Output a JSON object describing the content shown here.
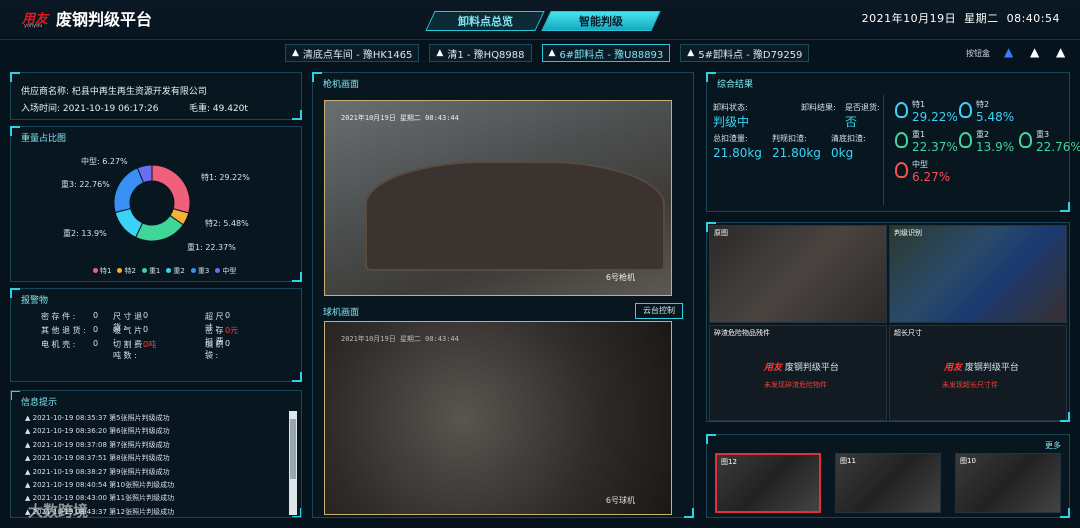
{
  "header": {
    "logo": "用友",
    "logo_sub": "yonyou",
    "title": "废钢判级平台",
    "tabs": [
      "卸料点总览",
      "智能判级"
    ],
    "active_tab": 1,
    "date": "2021年10月19日",
    "weekday": "星期二",
    "time": "08:40:54"
  },
  "vehicles": [
    {
      "label": "清底点车间 - 豫HK1465"
    },
    {
      "label": "清1 - 豫HQ8988"
    },
    {
      "label": "6#卸料点 - 豫U88893",
      "active": true
    },
    {
      "label": "5#卸料点 - 豫D79259"
    }
  ],
  "alarm_box": "按钮盒",
  "info": {
    "supplier_label": "供应商名称:",
    "supplier": "杞县中再生再生资源开发有限公司",
    "entry_label": "入场时间:",
    "entry_time": "2021-10-19 06:17:26",
    "weight_label": "毛重:",
    "weight": "49.420t"
  },
  "ratio": {
    "title": "重量占比图",
    "labels": [
      "特1: 29.22%",
      "特2: 5.48%",
      "重1: 22.37%",
      "重2: 13.9%",
      "重3: 22.76%",
      "中型: 6.27%"
    ],
    "legend": [
      "特1",
      "特2",
      "重1",
      "重2",
      "重3",
      "中型"
    ]
  },
  "chart_data": {
    "type": "pie",
    "categories": [
      "特1",
      "特2",
      "重1",
      "重2",
      "重3",
      "中型"
    ],
    "values": [
      29.22,
      5.48,
      22.37,
      13.9,
      22.76,
      6.27
    ],
    "colors": [
      "#f0607a",
      "#f5b335",
      "#3fd69a",
      "#3ad3f5",
      "#3a8ff5",
      "#6a6ef5"
    ]
  },
  "alarms": {
    "title": "报警物",
    "rows": [
      [
        "密 存 件 :",
        "0",
        "尺 寸 退 货 :",
        "0"
      ],
      [
        "超 尺 寸 :",
        "0",
        "其 他 退 货 :",
        "0"
      ],
      [
        "暖 气 片 :",
        "0",
        "密 存 扣 费 :",
        "0元"
      ],
      [
        "电 机 壳 :",
        "0",
        "切 割 费 吨 数 :",
        "0吨"
      ],
      [
        "编 织 袋 :",
        "0",
        "",
        ""
      ]
    ]
  },
  "logs": {
    "title": "信息提示",
    "rows": [
      "2021-10-19 08:35:37 第5张照片判级成功",
      "2021-10-19 08:36:20 第6张照片判级成功",
      "2021-10-19 08:37:08 第7张照片判级成功",
      "2021-10-19 08:37:51 第8张照片判级成功",
      "2021-10-19 08:38:27 第9张照片判级成功",
      "2021-10-19 08:40:54 第10张照片判级成功",
      "2021-10-19 08:43:00 第11张照片判级成功",
      "2021-10-19 08:43:37 第12张照片判级成功"
    ]
  },
  "cams": {
    "gun_title": "枪机画面",
    "gun_stamp": "2021年10月19日  星期二  08:43:44",
    "gun_label": "6号枪机",
    "dome_title": "球机画面",
    "ptz": "云台控制",
    "dome_stamp": "2021年10月19日 星期二 08:43:44",
    "dome_label": "6号球机"
  },
  "result": {
    "title": "综合结果",
    "status_lbl": "卸料状态:",
    "status": "判级中",
    "grade_lbl": "卸料结果:",
    "grade": "",
    "return_lbl": "是否退货:",
    "return": "否",
    "total_lbl": "总扣渣量:",
    "total": "21.80kg",
    "deduct_lbl": "判规扣渣:",
    "deduct": "21.80kg",
    "clean_lbl": "清底扣渣:",
    "clean": "0kg"
  },
  "grades": [
    {
      "name": "特1",
      "value": "29.22%",
      "color": "#3ad3f5"
    },
    {
      "name": "特2",
      "value": "5.48%",
      "color": "#3ad3f5"
    },
    {
      "name": "重1",
      "value": "22.37%",
      "color": "#3fd69a"
    },
    {
      "name": "重2",
      "value": "13.9%",
      "color": "#3fd69a"
    },
    {
      "name": "重3",
      "value": "22.76%",
      "color": "#3fd69a"
    },
    {
      "name": "中型",
      "value": "6.27%",
      "color": "#ff4d4d"
    }
  ],
  "views": {
    "original": "原图",
    "recog": "判级识别",
    "danger": "碎渣危险物品残件",
    "danger_msg": "未发现碎渣危险物件",
    "overlen": "超长尺寸",
    "overlen_msg": "未发现超长尺寸件",
    "brand": "废钢判级平台",
    "logo": "用友"
  },
  "gallery": {
    "more": "更多",
    "items": [
      "图12",
      "图11",
      "图10"
    ]
  },
  "watermark": "大数跨境"
}
